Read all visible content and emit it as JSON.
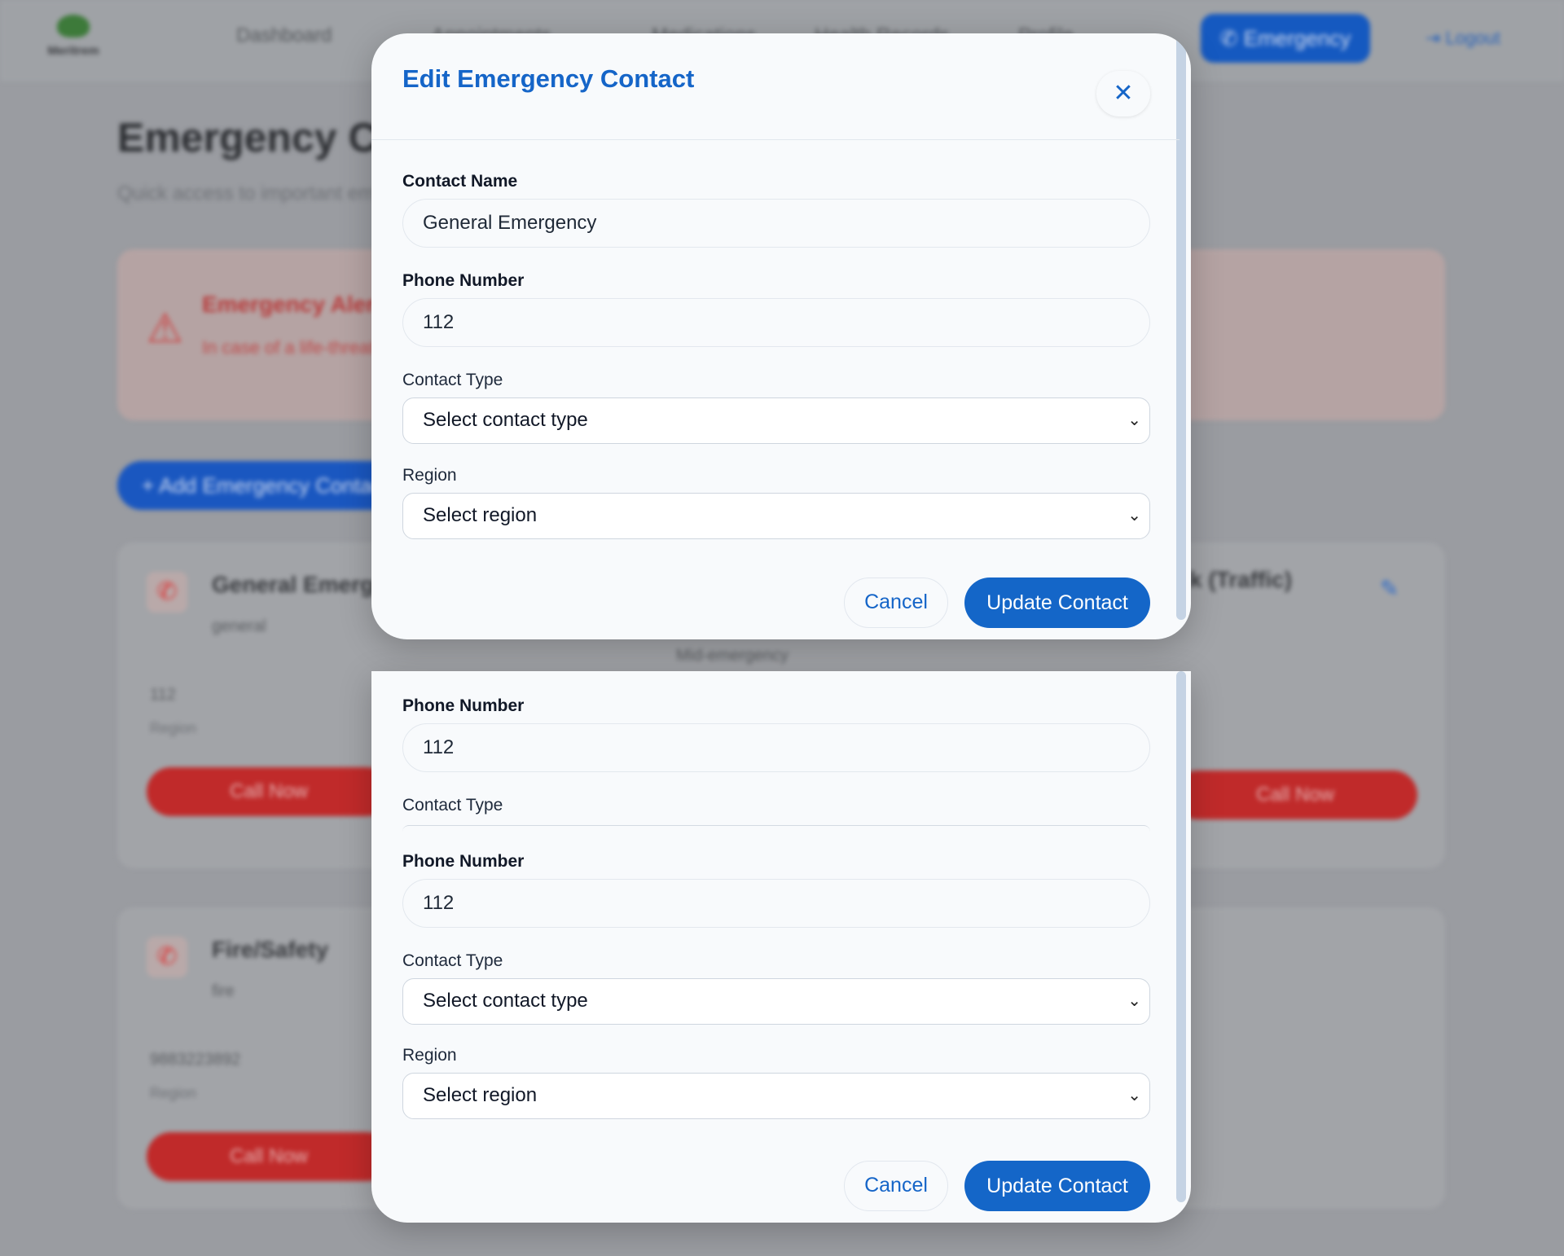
{
  "background": {
    "logo_text": "Meritrem",
    "nav": [
      "Dashboard",
      "Appointments",
      "Medications",
      "Health Records",
      "Profile"
    ],
    "emergency_button": "Emergency",
    "logout": "Logout",
    "page_title": "Emergency Contacts",
    "page_subtitle": "Quick access to important emergency contacts",
    "alert_title": "Emergency Alert",
    "alert_text": "In case of a life-threatening emergency, call immediately",
    "add_button": "+ Add Emergency Contact",
    "cards": [
      {
        "name": "General Emergency",
        "type": "general",
        "phone": "112",
        "region": "Region",
        "call": "Call Now"
      },
      {
        "name": "Fire/Safety",
        "type": "fire",
        "phone": "9883223892",
        "region": "Region",
        "call": "Call Now"
      }
    ],
    "card_right_title": "k (Traffic)",
    "card_right_call": "Call Now",
    "mid_label": "Mid-emergency"
  },
  "modal": {
    "title": "Edit Emergency Contact",
    "close_icon": "close-icon",
    "contact_name_label": "Contact Name",
    "contact_name_value": "General Emergency",
    "phone_label": "Phone Number",
    "phone_value": "112",
    "contact_type_label": "Contact Type",
    "contact_type_value": "Select contact type",
    "region_label": "Region",
    "region_value": "Select region",
    "cancel": "Cancel",
    "update": "Update Contact"
  },
  "colors": {
    "accent": "#1466c8",
    "danger": "#c02a2a"
  }
}
